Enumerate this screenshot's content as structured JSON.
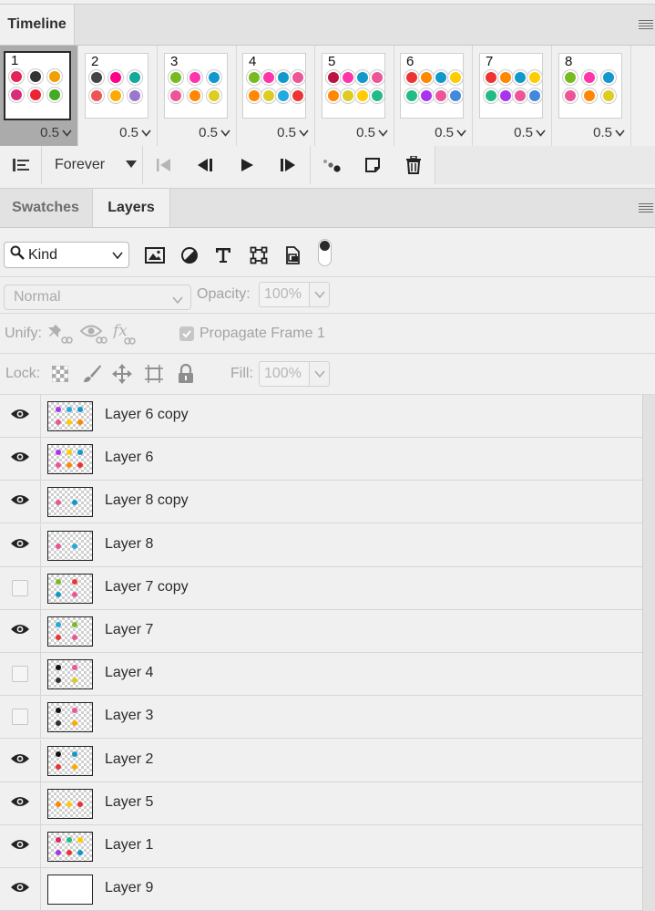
{
  "timeline": {
    "tab": "Timeline",
    "frames": [
      {
        "number": "1",
        "delay": "0.5",
        "selected": true,
        "colors": [
          "#e2245a",
          "#333",
          "#f0a000",
          "#d82c7a",
          "#e23",
          "#4a2"
        ]
      },
      {
        "number": "2",
        "delay": "0.5",
        "selected": false,
        "colors": [
          "#444",
          "#f08",
          "#1a9",
          "#e55",
          "#fa0",
          "#97c"
        ]
      },
      {
        "number": "3",
        "delay": "0.5",
        "selected": false,
        "colors": [
          "#7b2",
          "#f3a",
          "#19c",
          "#e59",
          "#f80",
          "#dc2"
        ]
      },
      {
        "number": "4",
        "delay": "0.5",
        "selected": false,
        "colors": [
          "#7b2",
          "#f3a",
          "#19c",
          "#e59",
          "#f80",
          "#dc2",
          "#2ad",
          "#e33"
        ]
      },
      {
        "number": "5",
        "delay": "0.5",
        "selected": false,
        "colors": [
          "#b14",
          "#f3a",
          "#19c",
          "#e59",
          "#f80",
          "#dc2",
          "#fc0",
          "#2b8"
        ]
      },
      {
        "number": "6",
        "delay": "0.5",
        "selected": false,
        "colors": [
          "#e33",
          "#f80",
          "#19c",
          "#fc0",
          "#2b8",
          "#a3e",
          "#e59",
          "#48d"
        ]
      },
      {
        "number": "7",
        "delay": "0.5",
        "selected": false,
        "colors": [
          "#e33",
          "#f80",
          "#19c",
          "#fc0",
          "#2b8",
          "#a3e",
          "#e59",
          "#48d"
        ]
      },
      {
        "number": "8",
        "delay": "0.5",
        "selected": false,
        "colors": [
          "#7b2",
          "#f3a",
          "#19c",
          "#e59",
          "#f80",
          "#dc2"
        ]
      }
    ],
    "loop": "Forever"
  },
  "layers_panel": {
    "tabs": [
      "Swatches",
      "Layers"
    ],
    "active_tab": "Layers",
    "filter_kind": "Kind",
    "blend_mode": "Normal",
    "opacity_label": "Opacity:",
    "opacity_value": "100%",
    "unify_label": "Unify:",
    "propagate_label": "Propagate Frame 1",
    "lock_label": "Lock:",
    "fill_label": "Fill:",
    "fill_value": "100%",
    "layers": [
      {
        "name": "Layer 6 copy",
        "visible": true,
        "dots": [
          "#a3e",
          "#2ad",
          "#19c",
          "#e59",
          "#fc0",
          "#f80"
        ]
      },
      {
        "name": "Layer 6",
        "visible": true,
        "dots": [
          "#a3e",
          "#fc0",
          "#19c",
          "#e59",
          "#f80",
          "#e33"
        ]
      },
      {
        "name": "Layer 8 copy",
        "visible": true,
        "dots": [
          "#e59",
          "#19c"
        ]
      },
      {
        "name": "Layer 8",
        "visible": true,
        "dots": [
          "#e59",
          "#2ad"
        ]
      },
      {
        "name": "Layer 7 copy",
        "visible": false,
        "dots": [
          "#7b2",
          "#e33",
          "#19c",
          "#e59"
        ]
      },
      {
        "name": "Layer 7",
        "visible": true,
        "dots": [
          "#2ad",
          "#7b2",
          "#e33",
          "#e59"
        ]
      },
      {
        "name": "Layer 4",
        "visible": false,
        "dots": [
          "#111",
          "#e59",
          "#333",
          "#dc2"
        ]
      },
      {
        "name": "Layer 3",
        "visible": false,
        "dots": [
          "#111",
          "#e59",
          "#333",
          "#fa0"
        ]
      },
      {
        "name": "Layer 2",
        "visible": true,
        "dots": [
          "#111",
          "#19c",
          "#e33",
          "#fa0"
        ]
      },
      {
        "name": "Layer 5",
        "visible": true,
        "dots": [
          "#f80",
          "#fc0",
          "#e33"
        ]
      },
      {
        "name": "Layer 1",
        "visible": true,
        "dots": [
          "#e2245a",
          "#2b8",
          "#fc0",
          "#a3e",
          "#e33",
          "#19c"
        ]
      },
      {
        "name": "Layer 9",
        "visible": true,
        "dots": [],
        "white": true
      }
    ]
  }
}
